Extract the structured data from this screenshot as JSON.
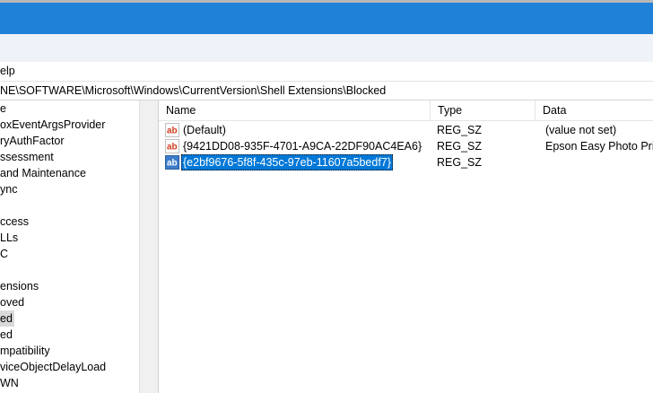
{
  "colors": {
    "titlebar": "#1f82d8",
    "selection": "#0078d7",
    "chrome": "#eff3f9"
  },
  "menu": {
    "help_label": "elp"
  },
  "address": {
    "path": "NE\\SOFTWARE\\Microsoft\\Windows\\CurrentVersion\\Shell Extensions\\Blocked"
  },
  "tree": {
    "items": [
      "e",
      "oxEventArgsProvider",
      "ryAuthFactor",
      "ssessment",
      " and Maintenance",
      "ync",
      "",
      "ccess",
      "LLs",
      "C",
      "",
      "ensions",
      "oved",
      "ed",
      "ed",
      "mpatibility",
      "viceObjectDelayLoad",
      "WN"
    ]
  },
  "list": {
    "headers": {
      "name": "Name",
      "type": "Type",
      "data": "Data"
    },
    "rows": [
      {
        "name": "(Default)",
        "type": "REG_SZ",
        "data": "(value not set)",
        "icon": "string-value-icon"
      },
      {
        "name": "{9421DD08-935F-4701-A9CA-22DF90AC4EA6}",
        "type": "REG_SZ",
        "data": "Epson Easy Photo Print",
        "icon": "string-value-icon"
      },
      {
        "name": "{e2bf9676-5f8f-435c-97eb-11607a5bedf7}",
        "type": "REG_SZ",
        "data": "",
        "icon": "string-value-icon",
        "selected": true
      }
    ]
  }
}
